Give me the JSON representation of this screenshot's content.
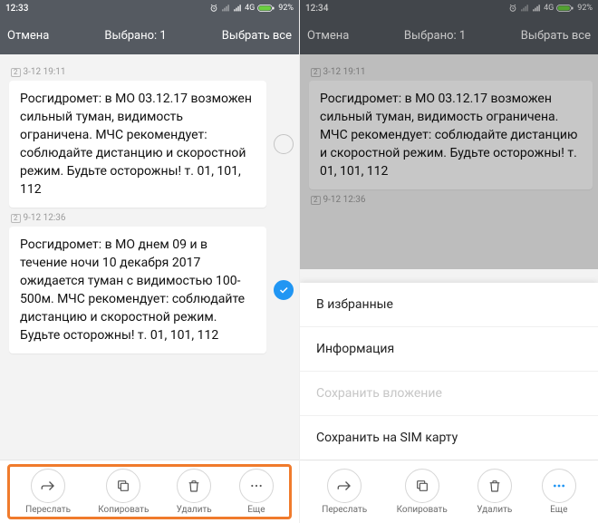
{
  "left": {
    "status": {
      "time": "12:33",
      "net": "4G",
      "battery": "92%"
    },
    "topbar": {
      "cancel": "Отмена",
      "title": "Выбрано: 1",
      "select_all": "Выбрать все"
    },
    "messages": [
      {
        "sim": "2",
        "time": "3-12 19:11",
        "text": "Росгидромет: в МО 03.12.17 возможен сильный туман, видимость ограничена. МЧС рекомендует: соблюдайте дистанцию и скоростной режим. Будьте осторожны! т. 01, 101, 112",
        "selected": false
      },
      {
        "sim": "2",
        "time": "9-12 12:36",
        "text": "Росгидромет: в МО днем 09 и в течение ночи 10 декабря 2017 ожидается туман с видимостью 100-500м. МЧС рекомендует: соблюдайте дистанцию и скоростной режим. Будьте осторожны! т. 01, 101, 112",
        "selected": true
      }
    ],
    "actions": {
      "forward": "Переслать",
      "copy": "Копировать",
      "delete": "Удалить",
      "more": "Еще"
    }
  },
  "right": {
    "status": {
      "time": "12:34",
      "net": "4G",
      "battery": "92%"
    },
    "topbar": {
      "cancel": "Отмена",
      "title": "Выбрано: 1",
      "select_all": "Выбрать все"
    },
    "messages": [
      {
        "sim": "2",
        "time": "3-12 19:11",
        "text": "Росгидромет: в МО 03.12.17 возможен сильный туман, видимость ограничена. МЧС рекомендует: соблюдайте дистанцию и скоростной режим. Будьте осторожны! т. 01, 101, 112",
        "selected": false
      },
      {
        "sim": "2",
        "time": "9-12 12:36"
      }
    ],
    "sheet": {
      "favorites": "В избранные",
      "info": "Информация",
      "save_attachment": "Сохранить вложение",
      "save_sim": "Сохранить на SIM карту"
    },
    "actions": {
      "forward": "Переслать",
      "copy": "Копировать",
      "delete": "Удалить",
      "more": "Еще"
    }
  }
}
